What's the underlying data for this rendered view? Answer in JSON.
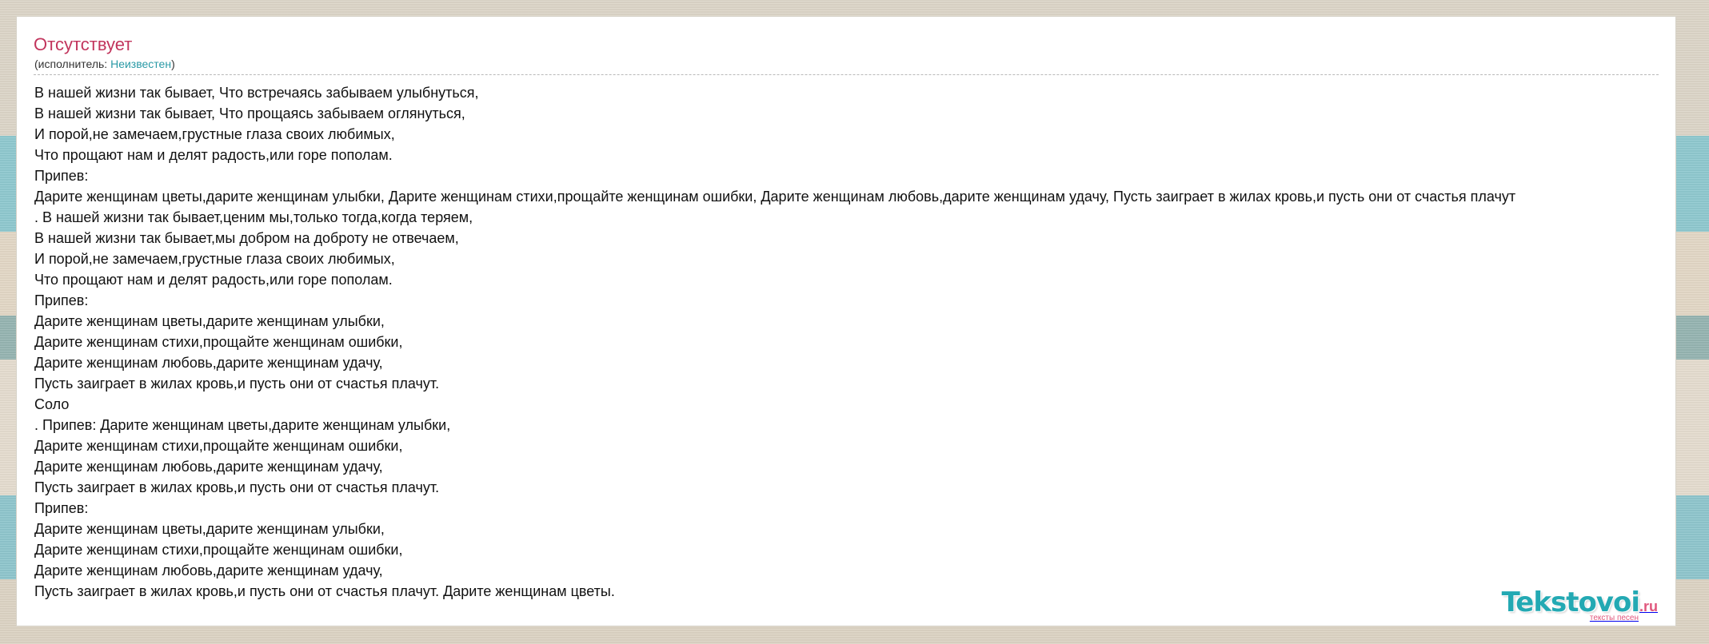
{
  "song": {
    "title": "Отсутствует",
    "artist_prefix": "(исполнитель: ",
    "artist_name": "Неизвестен",
    "artist_suffix": ")"
  },
  "lyrics": [
    "В нашей жизни так бывает, Что встречаясь забываем улыбнуться,",
    "В нашей жизни так бывает, Что прощаясь забываем оглянуться,",
    "И порой,не замечаем,грустные глаза своих любимых,",
    "Что прощают нам и делят радость,или горе пополам.",
    "Припев:",
    "Дарите женщинам цветы,дарите женщинам улыбки, Дарите женщинам стихи,прощайте женщинам ошибки, Дарите женщинам любовь,дарите женщинам удачу, Пусть заиграет в жилах кровь,и пусть они от счастья плачут",
    ". В нашей жизни так бывает,ценим мы,только тогда,когда теряем,",
    "В нашей жизни так бывает,мы добром на доброту не отвечаем,",
    "И порой,не замечаем,грустные глаза своих любимых,",
    "Что прощают нам и делят радость,или горе пополам.",
    "Припев:",
    "Дарите женщинам цветы,дарите женщинам улыбки,",
    "Дарите женщинам стихи,прощайте женщинам ошибки,",
    "Дарите женщинам любовь,дарите женщинам удачу,",
    "Пусть заиграет в жилах кровь,и пусть они от счастья плачут.",
    "Соло",
    ". Припев: Дарите женщинам цветы,дарите женщинам улыбки,",
    "Дарите женщинам стихи,прощайте женщинам ошибки,",
    "Дарите женщинам любовь,дарите женщинам удачу,",
    "Пусть заиграет в жилах кровь,и пусть они от счастья плачут.",
    "Припев:",
    "Дарите женщинам цветы,дарите женщинам улыбки,",
    "Дарите женщинам стихи,прощайте женщинам ошибки,",
    "Дарите женщинам любовь,дарите женщинам удачу,",
    "Пусть заиграет в жилах кровь,и пусть они от счастья плачут. Дарите женщинам цветы."
  ],
  "brand": {
    "name": "Tekstovoi",
    "tld": ".ru",
    "tagline": "тексты песен"
  },
  "colors": {
    "title": "#c2355d",
    "link": "#2a9aa6",
    "brand": "#23a9b3",
    "brand_accent": "#e0567c"
  }
}
